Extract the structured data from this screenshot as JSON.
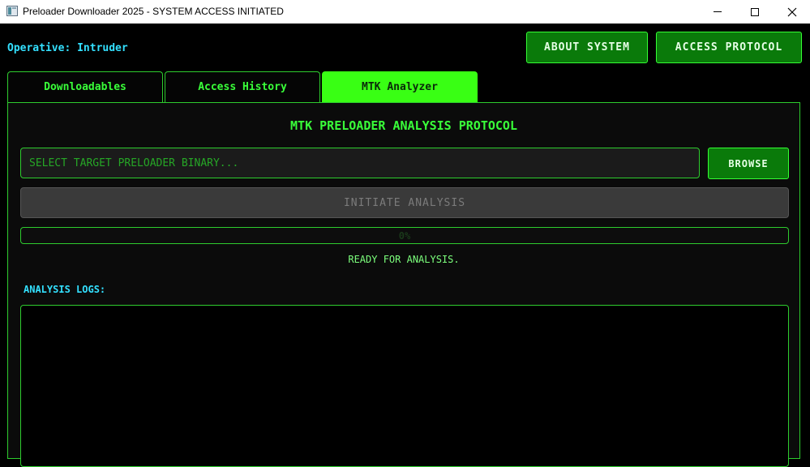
{
  "window": {
    "title": "Preloader Downloader 2025 - SYSTEM ACCESS INITIATED",
    "icon": "app-window-icon"
  },
  "header": {
    "operative": "Operative: Intruder",
    "about_label": "ABOUT SYSTEM",
    "protocol_label": "ACCESS PROTOCOL"
  },
  "tabs": [
    {
      "label": "Downloadables",
      "active": false
    },
    {
      "label": "Access History",
      "active": false
    },
    {
      "label": "MTK Analyzer",
      "active": true
    }
  ],
  "analyzer": {
    "title": "MTK PRELOADER ANALYSIS PROTOCOL",
    "file_value": "",
    "file_placeholder": "SELECT TARGET PRELOADER BINARY...",
    "browse_label": "BROWSE",
    "analyze_label": "INITIATE ANALYSIS",
    "progress_value": 0,
    "progress_text": "0%",
    "status": "READY FOR ANALYSIS.",
    "logs_label": "ANALYSIS LOGS:",
    "logs": ""
  },
  "colors": {
    "accent_green": "#39ff39",
    "button_green": "#0a7a0a",
    "cyan_label": "#33e0ff",
    "background": "#000000"
  }
}
